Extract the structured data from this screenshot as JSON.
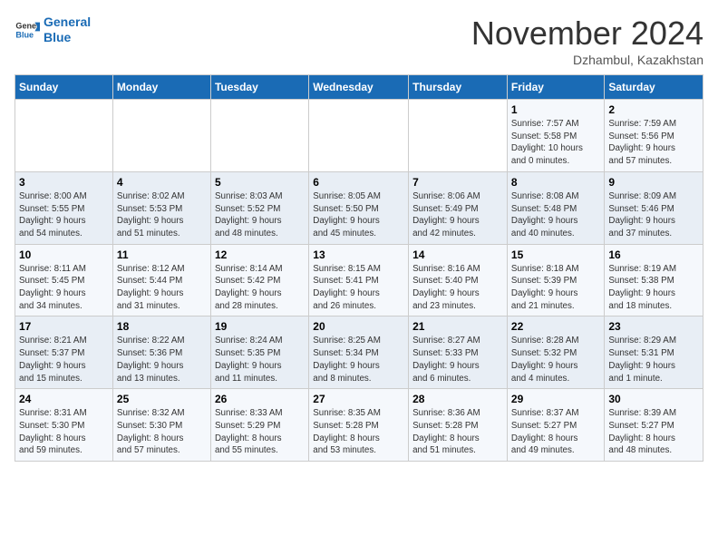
{
  "header": {
    "logo_line1": "General",
    "logo_line2": "Blue",
    "month": "November 2024",
    "location": "Dzhambul, Kazakhstan"
  },
  "weekdays": [
    "Sunday",
    "Monday",
    "Tuesday",
    "Wednesday",
    "Thursday",
    "Friday",
    "Saturday"
  ],
  "weeks": [
    [
      {
        "day": "",
        "info": ""
      },
      {
        "day": "",
        "info": ""
      },
      {
        "day": "",
        "info": ""
      },
      {
        "day": "",
        "info": ""
      },
      {
        "day": "",
        "info": ""
      },
      {
        "day": "1",
        "info": "Sunrise: 7:57 AM\nSunset: 5:58 PM\nDaylight: 10 hours\nand 0 minutes."
      },
      {
        "day": "2",
        "info": "Sunrise: 7:59 AM\nSunset: 5:56 PM\nDaylight: 9 hours\nand 57 minutes."
      }
    ],
    [
      {
        "day": "3",
        "info": "Sunrise: 8:00 AM\nSunset: 5:55 PM\nDaylight: 9 hours\nand 54 minutes."
      },
      {
        "day": "4",
        "info": "Sunrise: 8:02 AM\nSunset: 5:53 PM\nDaylight: 9 hours\nand 51 minutes."
      },
      {
        "day": "5",
        "info": "Sunrise: 8:03 AM\nSunset: 5:52 PM\nDaylight: 9 hours\nand 48 minutes."
      },
      {
        "day": "6",
        "info": "Sunrise: 8:05 AM\nSunset: 5:50 PM\nDaylight: 9 hours\nand 45 minutes."
      },
      {
        "day": "7",
        "info": "Sunrise: 8:06 AM\nSunset: 5:49 PM\nDaylight: 9 hours\nand 42 minutes."
      },
      {
        "day": "8",
        "info": "Sunrise: 8:08 AM\nSunset: 5:48 PM\nDaylight: 9 hours\nand 40 minutes."
      },
      {
        "day": "9",
        "info": "Sunrise: 8:09 AM\nSunset: 5:46 PM\nDaylight: 9 hours\nand 37 minutes."
      }
    ],
    [
      {
        "day": "10",
        "info": "Sunrise: 8:11 AM\nSunset: 5:45 PM\nDaylight: 9 hours\nand 34 minutes."
      },
      {
        "day": "11",
        "info": "Sunrise: 8:12 AM\nSunset: 5:44 PM\nDaylight: 9 hours\nand 31 minutes."
      },
      {
        "day": "12",
        "info": "Sunrise: 8:14 AM\nSunset: 5:42 PM\nDaylight: 9 hours\nand 28 minutes."
      },
      {
        "day": "13",
        "info": "Sunrise: 8:15 AM\nSunset: 5:41 PM\nDaylight: 9 hours\nand 26 minutes."
      },
      {
        "day": "14",
        "info": "Sunrise: 8:16 AM\nSunset: 5:40 PM\nDaylight: 9 hours\nand 23 minutes."
      },
      {
        "day": "15",
        "info": "Sunrise: 8:18 AM\nSunset: 5:39 PM\nDaylight: 9 hours\nand 21 minutes."
      },
      {
        "day": "16",
        "info": "Sunrise: 8:19 AM\nSunset: 5:38 PM\nDaylight: 9 hours\nand 18 minutes."
      }
    ],
    [
      {
        "day": "17",
        "info": "Sunrise: 8:21 AM\nSunset: 5:37 PM\nDaylight: 9 hours\nand 15 minutes."
      },
      {
        "day": "18",
        "info": "Sunrise: 8:22 AM\nSunset: 5:36 PM\nDaylight: 9 hours\nand 13 minutes."
      },
      {
        "day": "19",
        "info": "Sunrise: 8:24 AM\nSunset: 5:35 PM\nDaylight: 9 hours\nand 11 minutes."
      },
      {
        "day": "20",
        "info": "Sunrise: 8:25 AM\nSunset: 5:34 PM\nDaylight: 9 hours\nand 8 minutes."
      },
      {
        "day": "21",
        "info": "Sunrise: 8:27 AM\nSunset: 5:33 PM\nDaylight: 9 hours\nand 6 minutes."
      },
      {
        "day": "22",
        "info": "Sunrise: 8:28 AM\nSunset: 5:32 PM\nDaylight: 9 hours\nand 4 minutes."
      },
      {
        "day": "23",
        "info": "Sunrise: 8:29 AM\nSunset: 5:31 PM\nDaylight: 9 hours\nand 1 minute."
      }
    ],
    [
      {
        "day": "24",
        "info": "Sunrise: 8:31 AM\nSunset: 5:30 PM\nDaylight: 8 hours\nand 59 minutes."
      },
      {
        "day": "25",
        "info": "Sunrise: 8:32 AM\nSunset: 5:30 PM\nDaylight: 8 hours\nand 57 minutes."
      },
      {
        "day": "26",
        "info": "Sunrise: 8:33 AM\nSunset: 5:29 PM\nDaylight: 8 hours\nand 55 minutes."
      },
      {
        "day": "27",
        "info": "Sunrise: 8:35 AM\nSunset: 5:28 PM\nDaylight: 8 hours\nand 53 minutes."
      },
      {
        "day": "28",
        "info": "Sunrise: 8:36 AM\nSunset: 5:28 PM\nDaylight: 8 hours\nand 51 minutes."
      },
      {
        "day": "29",
        "info": "Sunrise: 8:37 AM\nSunset: 5:27 PM\nDaylight: 8 hours\nand 49 minutes."
      },
      {
        "day": "30",
        "info": "Sunrise: 8:39 AM\nSunset: 5:27 PM\nDaylight: 8 hours\nand 48 minutes."
      }
    ]
  ]
}
